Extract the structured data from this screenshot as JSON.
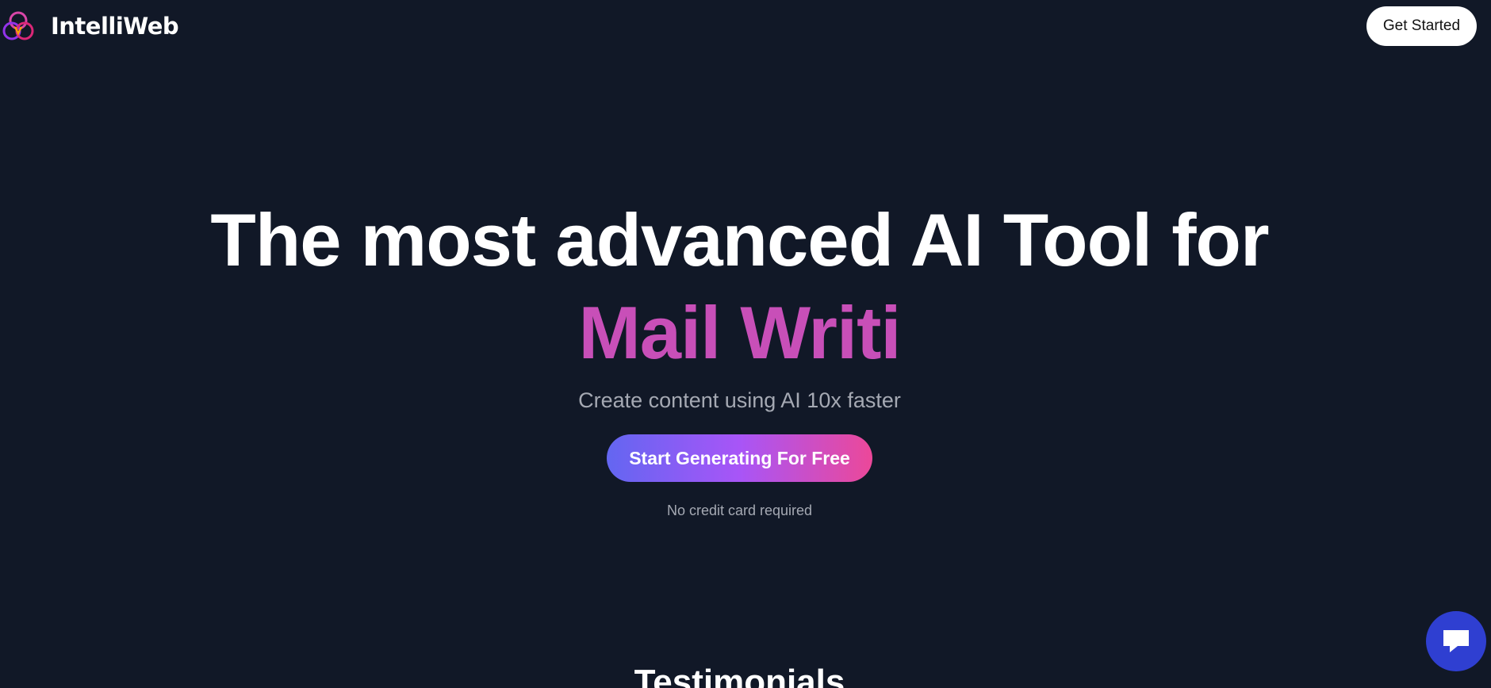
{
  "navbar": {
    "brand_name": "IntelliWeb",
    "cta_label": "Get Started"
  },
  "hero": {
    "headline": "The most advanced AI Tool for",
    "typed_text": "Mail Writi",
    "subheadline": "Create content using AI 10x faster",
    "cta_label": "Start Generating For Free",
    "note": "No credit card required"
  },
  "sections": {
    "testimonials_title": "Testimonials"
  },
  "icons": {
    "logo": "three-rings-logo-icon",
    "chat": "chat-bubble-icon"
  },
  "colors": {
    "background": "#111827",
    "typed_text": "#c84fb8",
    "cta_gradient": [
      "#6366f1",
      "#a855f7",
      "#ec4899"
    ],
    "chat_widget": "#2f3fd1"
  }
}
